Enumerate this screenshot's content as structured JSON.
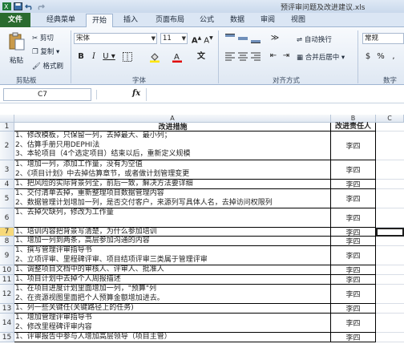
{
  "window": {
    "title": "预评审问题及改进建议.xls"
  },
  "tabs": [
    {
      "label": "文件"
    },
    {
      "label": "经典菜单"
    },
    {
      "label": "开始"
    },
    {
      "label": "插入"
    },
    {
      "label": "页面布局"
    },
    {
      "label": "公式"
    },
    {
      "label": "数据"
    },
    {
      "label": "审阅"
    },
    {
      "label": "视图"
    }
  ],
  "ribbon": {
    "clipboard": {
      "paste": "粘贴",
      "cut": "剪切",
      "copy": "复制 ▾",
      "format_painter": "格式刷",
      "group": "剪贴板"
    },
    "font": {
      "name": "宋体",
      "size": "11",
      "group": "字体",
      "bold": "B",
      "italic": "I",
      "underline": "U ▾"
    },
    "alignment": {
      "wrap": "自动换行",
      "merge": "合并后居中 ▾",
      "group": "对齐方式"
    },
    "number": {
      "format": "常规",
      "group": "数字",
      "percent": "%",
      "comma": ","
    }
  },
  "formula_bar": {
    "cell_ref": "C7",
    "fx": "fx",
    "value": ""
  },
  "columns": {
    "a": "A",
    "b": "B",
    "c": "C"
  },
  "rows": [
    {
      "n": "1",
      "lines": [
        "改进措施"
      ],
      "owner": "改进责任人",
      "header": true
    },
    {
      "n": "2",
      "lines": [
        "1、修改模板，只保留一列，去掉最大、最小列；",
        "2、估算手册只用DEPHI法",
        "3、本轮项目（4个选定项目）结束以后，重新定义规模"
      ],
      "owner": "李四"
    },
    {
      "n": "3",
      "lines": [
        "1、增加一列，添加工作量，没有为空值",
        "2、《项目计划》中去掉估算章节，或者做计划管理变更"
      ],
      "owner": "李四"
    },
    {
      "n": "4",
      "lines": [
        "1、把风险的实际背景列全，前后一致，解决方法要详细"
      ],
      "owner": "李四"
    },
    {
      "n": "5",
      "lines": [
        "1、交付清单去掉，重新整理项目数据管理内容",
        "2、数据管理计划增加一列，是否交付客户，来源列写具体人名，去掉访问权限列"
      ],
      "owner": "李四"
    },
    {
      "n": "6",
      "lines": [
        "1、去掉欠缺列，修改为工作量"
      ],
      "owner": "李四"
    },
    {
      "n": "7",
      "lines": [
        "1、培训内容把背景写清楚，为什么参加培训"
      ],
      "owner": "李四",
      "selected": true
    },
    {
      "n": "8",
      "lines": [
        "1、增加一列到两条，高层参加沟通的内容"
      ],
      "owner": "李四"
    },
    {
      "n": "9",
      "lines": [
        "1、撰写管理评审指导书",
        "2、立项评审、里程碑评审、项目结项评审三类属于管理评审"
      ],
      "owner": "李四"
    },
    {
      "n": "10",
      "lines": [
        "1、调整项目文档中的审核人、评审人、批准人"
      ],
      "owner": "李四"
    },
    {
      "n": "11",
      "lines": [
        "1、项目计划中去掉个人周报描述"
      ],
      "owner": "李四"
    },
    {
      "n": "12",
      "lines": [
        "1、在项目进度计划里面增加一列，\"预算\"列",
        "2、在资源视图里面把个人预算金额增加进去。"
      ],
      "owner": "李四"
    },
    {
      "n": "13",
      "lines": [
        "1、列一些关键任(关键路径上的任务)"
      ],
      "owner": "李四"
    },
    {
      "n": "14",
      "lines": [
        "1、增加管理评审指导书",
        "2、修改里程碑评审内容"
      ],
      "owner": "李四"
    },
    {
      "n": "15",
      "lines": [
        "1、评审报告中参与人增加高层领导（项目主管）"
      ],
      "owner": "李四"
    }
  ]
}
